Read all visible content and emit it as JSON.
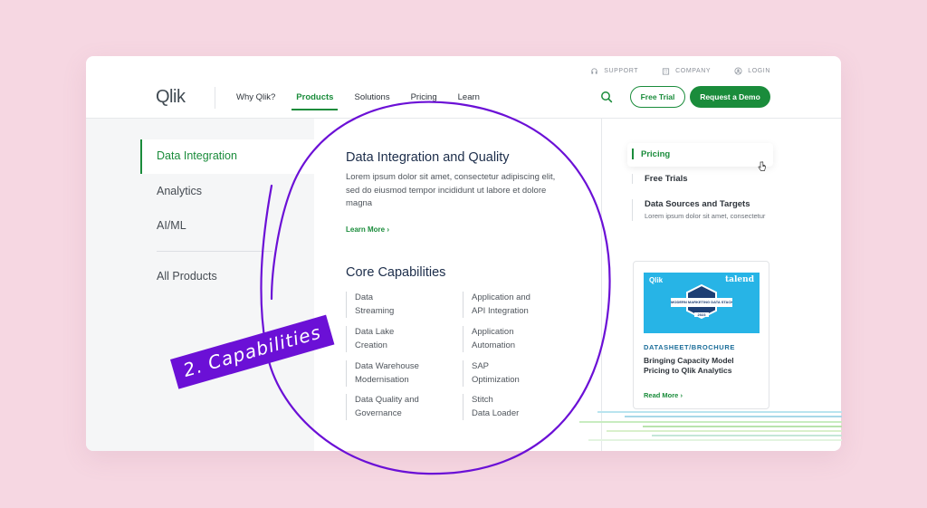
{
  "utility_nav": [
    {
      "label": "SUPPORT",
      "icon": "headset-icon"
    },
    {
      "label": "COMPANY",
      "icon": "building-icon"
    },
    {
      "label": "LOGIN",
      "icon": "user-icon"
    }
  ],
  "logo": "Qlik",
  "menu": [
    {
      "label": "Why Qlik?",
      "active": false
    },
    {
      "label": "Products",
      "active": true
    },
    {
      "label": "Solutions",
      "active": false
    },
    {
      "label": "Pricing",
      "active": false
    },
    {
      "label": "Learn",
      "active": false
    }
  ],
  "buttons": {
    "trial": "Free Trial",
    "demo": "Request a Demo"
  },
  "left_nav": {
    "active": "Data Integration",
    "items": [
      "Analytics",
      "AI/ML"
    ],
    "all": "All Products"
  },
  "main": {
    "title": "Data Integration and Quality",
    "description": "Lorem ipsum dolor sit amet, consectetur adipiscing elit, sed do eiusmod tempor incididunt ut labore et dolore magna",
    "learn_more": "Learn More",
    "capabilities_title": "Core Capabilities",
    "capabilities": [
      [
        "Data",
        "Streaming"
      ],
      [
        "Application and",
        "API Integration"
      ],
      [
        "Data Lake",
        "Creation"
      ],
      [
        "Application",
        "Automation"
      ],
      [
        "Data Warehouse",
        "Modernisation"
      ],
      [
        "SAP",
        "Optimization"
      ],
      [
        "Data Quality and",
        "Governance"
      ],
      [
        "Stitch",
        "Data Loader"
      ]
    ]
  },
  "right": {
    "pricing": "Pricing",
    "free_trials": "Free Trials",
    "sources_title": "Data Sources and Targets",
    "sources_desc": "Lorem ipsum dolor sit amet, consectetur"
  },
  "promo": {
    "tag": "DATASHEET/BROCHURE",
    "title": "Bringing Capacity Model Pricing to Qlik Analytics",
    "read_more": "Read More",
    "image_brand_left": "Qlik",
    "image_brand_right": "talend",
    "badge_text": "MODERN MARKETING DATA STACK",
    "badge_year": "2023"
  },
  "annotation": "2. Capabilities",
  "colors": {
    "accent": "#1a8c3b",
    "highlight": "#6b10d6",
    "background": "#f6d7e2"
  }
}
